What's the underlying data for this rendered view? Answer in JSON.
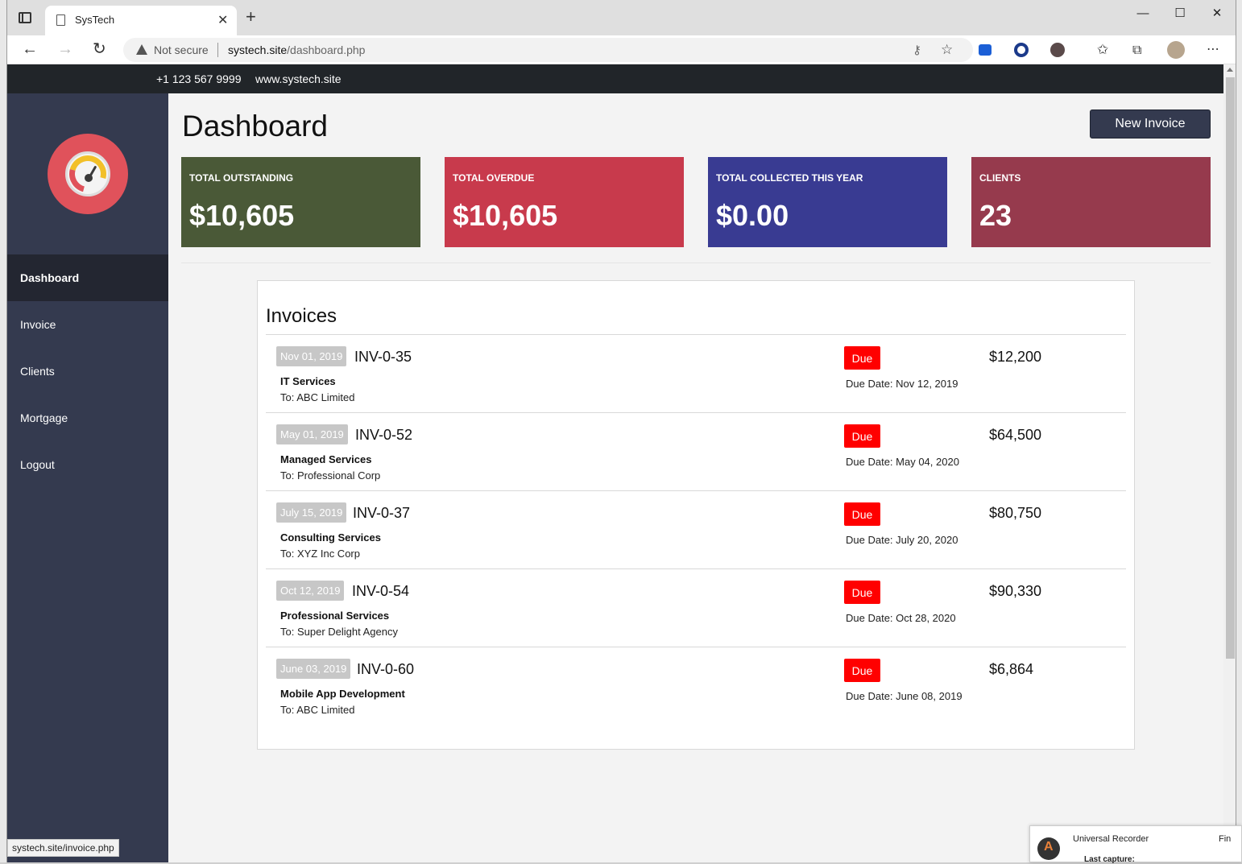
{
  "browser": {
    "tab_title": "SysTech",
    "security_label": "Not secure",
    "url_host": "systech.site",
    "url_path": "/dashboard.php",
    "status_link": "systech.site/invoice.php"
  },
  "topbar": {
    "phone": "+1 123 567 9999",
    "website": "www.systech.site"
  },
  "sidebar": {
    "items": [
      {
        "label": "Dashboard",
        "active": true
      },
      {
        "label": "Invoice"
      },
      {
        "label": "Clients"
      },
      {
        "label": "Mortgage"
      },
      {
        "label": "Logout"
      }
    ]
  },
  "header": {
    "title": "Dashboard",
    "new_invoice_label": "New Invoice"
  },
  "stats": [
    {
      "label": "TOTAL OUTSTANDING",
      "value": "$10,605",
      "color": "#4a5937"
    },
    {
      "label": "TOTAL OVERDUE",
      "value": "$10,605",
      "color": "#c83a4c"
    },
    {
      "label": "TOTAL COLLECTED THIS YEAR",
      "value": "$0.00",
      "color": "#393b92"
    },
    {
      "label": "CLIENTS",
      "value": "23",
      "color": "#963a4d"
    }
  ],
  "invoices": {
    "title": "Invoices",
    "rows": [
      {
        "date": "Nov 01, 2019",
        "number": "INV-0-35",
        "service": "IT Services",
        "to": "To: ABC Limited",
        "status": "Due",
        "due_date": "Due Date: Nov 12, 2019",
        "amount": "$12,200"
      },
      {
        "date": "May 01, 2019",
        "number": "INV-0-52",
        "service": "Managed Services",
        "to": "To: Professional Corp",
        "status": "Due",
        "due_date": "Due Date: May 04, 2020",
        "amount": "$64,500"
      },
      {
        "date": "July 15, 2019",
        "number": "INV-0-37",
        "service": "Consulting Services",
        "to": "To: XYZ Inc Corp",
        "status": "Due",
        "due_date": "Due Date: July 20, 2020",
        "amount": "$80,750"
      },
      {
        "date": "Oct 12, 2019",
        "number": "INV-0-54",
        "service": "Professional Services",
        "to": "To: Super Delight Agency",
        "status": "Due",
        "due_date": "Due Date: Oct 28, 2020",
        "amount": "$90,330"
      },
      {
        "date": "June 03, 2019",
        "number": "INV-0-60",
        "service": "Mobile App Development",
        "to": "To: ABC Limited",
        "status": "Due",
        "due_date": "Due Date: June 08, 2019",
        "amount": "$6,864"
      }
    ]
  },
  "recorder": {
    "title": "Universal Recorder",
    "finish_label": "Fin",
    "last_capture_label": "Last capture:"
  }
}
